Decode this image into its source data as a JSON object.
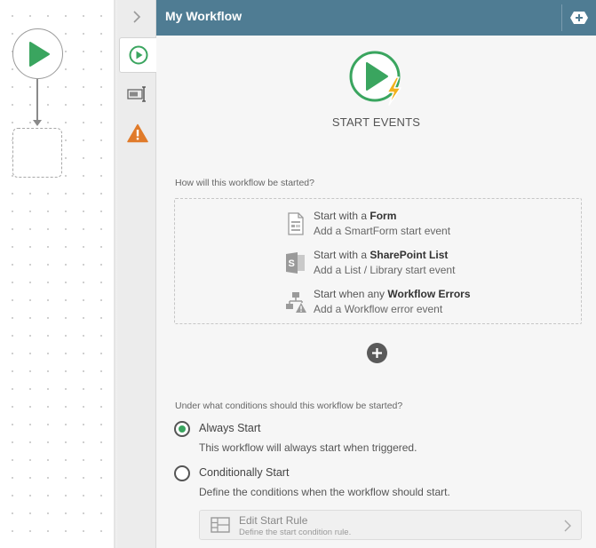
{
  "header": {
    "title": "My Workflow"
  },
  "hero": {
    "title": "START EVENTS"
  },
  "start_question": "How will this workflow be started?",
  "start_options": [
    {
      "prefix": "Start with a ",
      "bold": "Form",
      "subtitle": "Add a SmartForm start event",
      "icon": "form-icon"
    },
    {
      "prefix": "Start with a ",
      "bold": "SharePoint List",
      "subtitle": "Add a List / Library start event",
      "icon": "sharepoint-icon"
    },
    {
      "prefix": "Start when any ",
      "bold": "Workflow Errors",
      "subtitle": "Add a Workflow error event",
      "icon": "workflow-error-icon"
    }
  ],
  "conditions_question": "Under what conditions should this workflow be started?",
  "conditions": [
    {
      "label": "Always Start",
      "description": "This workflow will always start when triggered.",
      "checked": true
    },
    {
      "label": "Conditionally Start",
      "description": "Define the conditions when the workflow should start.",
      "checked": false
    }
  ],
  "rule": {
    "title": "Edit Start Rule",
    "subtitle": "Define the start condition rule."
  },
  "colors": {
    "header": "#4f7c93",
    "accent_green": "#3aa55f",
    "warning_orange": "#e07b2a",
    "lightning": "#f2b21c"
  },
  "icons": [
    "chevron-right-icon",
    "play-icon",
    "text-cursor-icon",
    "warning-icon",
    "add-step-icon",
    "plus-icon",
    "rule-table-icon"
  ]
}
